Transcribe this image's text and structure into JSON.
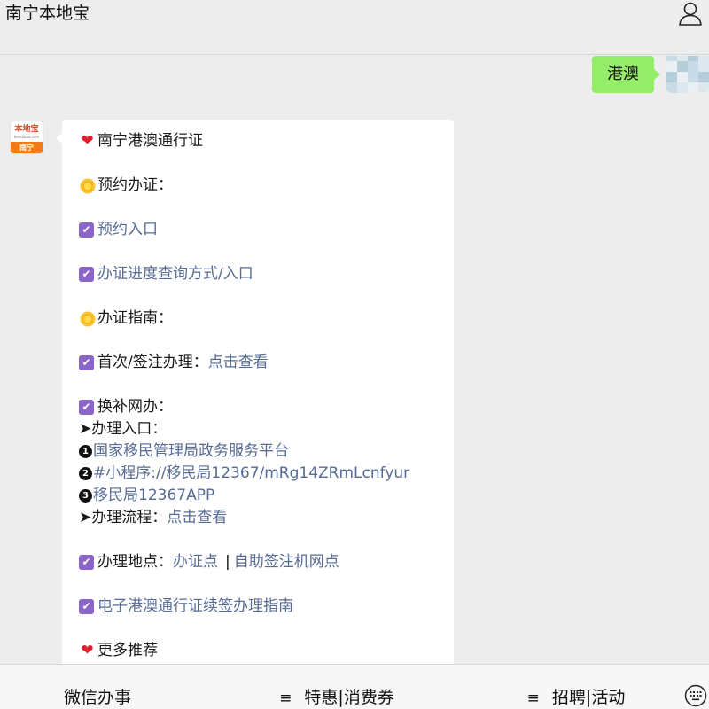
{
  "header": {
    "title": "南宁本地宝"
  },
  "conversation": {
    "outgoing_text": "港澳",
    "bot_avatar": {
      "top": "本地宝",
      "sub": "bendibao.com",
      "city": "南宁"
    },
    "message": {
      "title": "南宁港澳通行证",
      "section1": "预约办证：",
      "link_appointment": "预约入口",
      "link_progress": "办证进度查询方式/入口",
      "section2": "办证指南：",
      "first_visa_label": "首次/签注办理：",
      "first_visa_link": "点击查看",
      "replace_title": "换补网办：",
      "entry_label": "➤办理入口：",
      "entry1_num": "1",
      "entry1": "国家移民管理局政务服务平台",
      "entry2_num": "2",
      "entry2": "#小程序://移民局12367/mRg14ZRmLcnfyur",
      "entry3_num": "3",
      "entry3": "移民局12367APP",
      "process_label": "➤办理流程：",
      "process_link": "点击查看",
      "location_label": "办理地点：",
      "location_link1": "办证点",
      "location_sep": "|",
      "location_link2": "自助签注机网点",
      "e_pass_link": "电子港澳通行证续签办理指南",
      "more": "更多推荐"
    }
  },
  "footer": {
    "menu1": "微信办事",
    "menu2": "特惠|消费券",
    "menu3": "招聘|活动",
    "menu_icon": "≡"
  },
  "icons": {
    "heart": "heart-icon",
    "sun": "sun-icon",
    "check": "checkbox-icon",
    "profile": "person-icon",
    "keyboard": "keyboard-icon"
  },
  "colors": {
    "link": "#576b95",
    "outgoing_bubble": "#95ec69",
    "checkbox": "#8a64c8",
    "heart": "#e0212b"
  }
}
